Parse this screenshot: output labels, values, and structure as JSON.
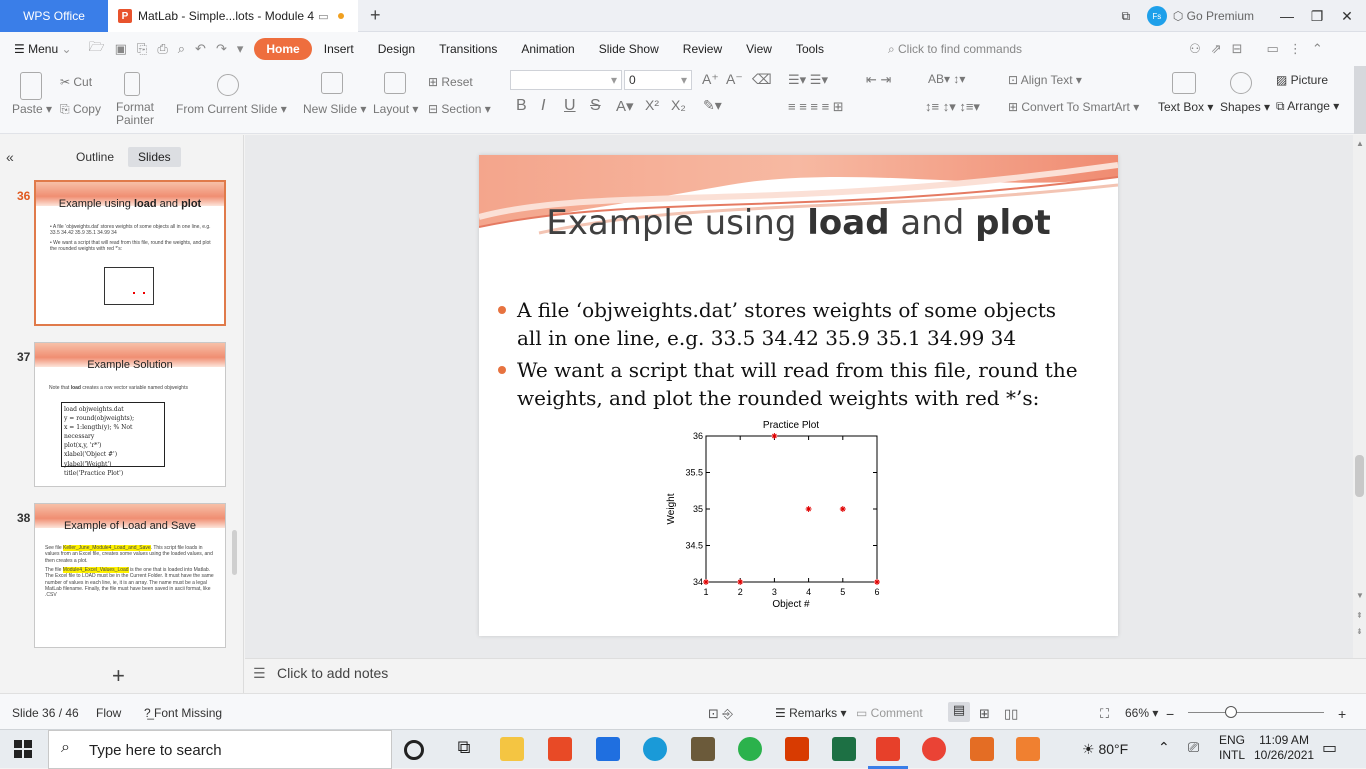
{
  "titlebar": {
    "app_tab": "WPS Office",
    "doc_tab": "MatLab - Simple...lots - Module 4",
    "new_tab": "+",
    "go_premium": "Go Premium",
    "avatar_initials": "Fs",
    "minimize": "—",
    "restore": "❐",
    "close": "✕"
  },
  "menubar": {
    "menu_label": "Menu",
    "tabs": [
      "Home",
      "Insert",
      "Design",
      "Transitions",
      "Animation",
      "Slide Show",
      "Review",
      "View",
      "Tools"
    ],
    "search_placeholder": "Click to find commands"
  },
  "ribbon": {
    "paste": "Paste",
    "cut": "Cut",
    "copy": "Copy",
    "format_painter_1": "Format",
    "format_painter_2": "Painter",
    "from_current_slide": "From Current Slide",
    "new_slide": "New Slide",
    "layout": "Layout",
    "reset": "Reset",
    "section": "Section",
    "font_size_value": "0",
    "align_text": "Align Text",
    "convert_smartart": "Convert To SmartArt",
    "text_box": "Text Box",
    "shapes": "Shapes",
    "picture": "Picture",
    "arrange": "Arrange"
  },
  "left_panel": {
    "outline_tab": "Outline",
    "slides_tab": "Slides",
    "add_slide": "+",
    "thumbs": [
      {
        "number": "36",
        "title_plain": "Example using ",
        "title_bold1": "load",
        "title_and": " and ",
        "title_bold2": "plot",
        "bullet1": "• A file ‘objweights.dat’ stores weights of some objects all in one line, e.g. 33.5 34.42 35.9 35.1 34.99 34",
        "bullet2": "• We want a script that will read from this file, round the weights, and plot the rounded weights with red *’s:"
      },
      {
        "number": "37",
        "title": "Example Solution",
        "note_pre": "Note that ",
        "note_bold": "load",
        "note_post": " creates a row vector variable named objweights",
        "code": [
          "load objweights.dat",
          "y = round(objweights);",
          "x = 1:length(y); % Not necessary",
          "plot(x,y, 'r*')",
          "xlabel('Object #')",
          "ylabel('Weight')",
          "title('Practice Plot')"
        ]
      },
      {
        "number": "38",
        "title": "Example of Load and Save",
        "p1_pre": "See file ",
        "p1_hl": "Keller_June_Module4_Load_and_Save",
        "p1_post": ". This script file loads in values from an Excel file, creates some values using the loaded values, and then creates a plot.",
        "p2_pre": "The file ",
        "p2_hl": "Module4_Excel_Values_Load",
        "p2_post": " is the one that is loaded into Matlab. The Excel file to LOAD must be in the Current Folder. It must have the same number of values in each line, ie, it is an array. The name must be a legal MatLab filename. Finally, the file must have been saved in ascii format, like .CSV"
      }
    ]
  },
  "slide": {
    "title_plain": "Example using ",
    "title_bold1": "load",
    "title_and": " and ",
    "title_bold2": "plot",
    "bullet1_line1": "A file ‘objweights.dat’ stores weights of some objects",
    "bullet1_line2": "all in one line, e.g.   33.5  34.42  35.9   35.1  34.99  34",
    "bullet2_line1": "We want a script that will read from this file, round the",
    "bullet2_line2": "weights, and plot the rounded weights with red *’s:"
  },
  "chart_data": {
    "type": "scatter",
    "title": "Practice Plot",
    "xlabel": "Object #",
    "ylabel": "Weight",
    "x": [
      1,
      2,
      3,
      4,
      5,
      6
    ],
    "y": [
      34,
      34,
      36,
      35,
      35,
      34
    ],
    "xlim": [
      1,
      6
    ],
    "ylim": [
      34,
      36
    ],
    "xticks": [
      "1",
      "2",
      "3",
      "4",
      "5",
      "6"
    ],
    "yticks": [
      "34",
      "34.5",
      "35",
      "35.5",
      "36"
    ],
    "marker": "*",
    "marker_color": "#e00000",
    "grid": false
  },
  "notes": {
    "placeholder": "Click to add notes"
  },
  "statusbar": {
    "slide_counter": "Slide 36 / 46",
    "flow": "Flow",
    "font_missing": "Font Missing",
    "remarks": "Remarks",
    "comment": "Comment",
    "zoom": "66%"
  },
  "taskbar": {
    "search_placeholder": "Type here to search",
    "weather": "80°F",
    "lang1": "ENG",
    "lang2": "INTL",
    "time": "11:09 AM",
    "date": "10/26/2021"
  },
  "colors": {
    "accent": "#ee6e3e",
    "wps_blue": "#3a7ee8",
    "bullet": "#e77340",
    "marker": "#e00000"
  }
}
